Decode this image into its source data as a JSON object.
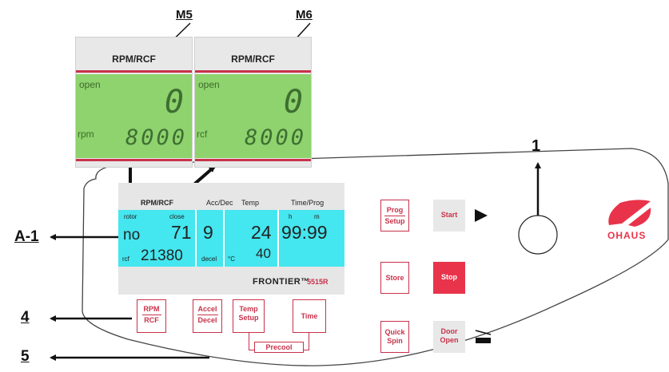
{
  "callouts": {
    "m5": "M5",
    "m6": "M6",
    "one": "1",
    "a1": "A-1",
    "four": "4",
    "five": "5"
  },
  "inset_left": {
    "title": "RPM/RCF",
    "status": "open",
    "top_value": "0",
    "unit": "rpm",
    "speed": "8000"
  },
  "inset_right": {
    "title": "RPM/RCF",
    "status": "open",
    "top_value": "0",
    "unit": "rcf",
    "speed": "8000"
  },
  "display": {
    "headers": {
      "rpm_rcf": "RPM/RCF",
      "acc_dec": "Acc/Dec",
      "temp": "Temp",
      "time_prog": "Time/Prog"
    },
    "rotor_label": "rotor",
    "close_label": "close",
    "rotor_value": "no",
    "speed_value": "71",
    "rcf_label": "rcf",
    "rcf_value": "21380",
    "accel_value": "9",
    "decel_label": "decel",
    "temp_value": "24",
    "temp_unit": "°C",
    "temp_set": "40",
    "h_label": "h",
    "m_label": "m",
    "time_value": "99:99",
    "brand_name": "FRONTIER™",
    "brand_model": "5515R"
  },
  "buttons": {
    "rpm_top": "RPM",
    "rpm_bottom": "RCF",
    "accel_top": "Accel",
    "accel_bottom": "Decel",
    "temp_top": "Temp",
    "temp_bottom": "Setup",
    "time": "Time",
    "precool": "Precool",
    "prog_top": "Prog",
    "prog_bottom": "Setup",
    "start": "Start",
    "store": "Store",
    "stop": "Stop",
    "quick_top": "Quick",
    "quick_bottom": "Spin",
    "door_top": "Door",
    "door_bottom": "Open"
  },
  "logo": {
    "text": "OHAUS",
    "color": "#e8334a"
  },
  "colors": {
    "lcd_green": "#8ed36e",
    "display_cyan": "#44e6ef",
    "accent_red": "#c8324a",
    "stop_red": "#e8334a"
  }
}
